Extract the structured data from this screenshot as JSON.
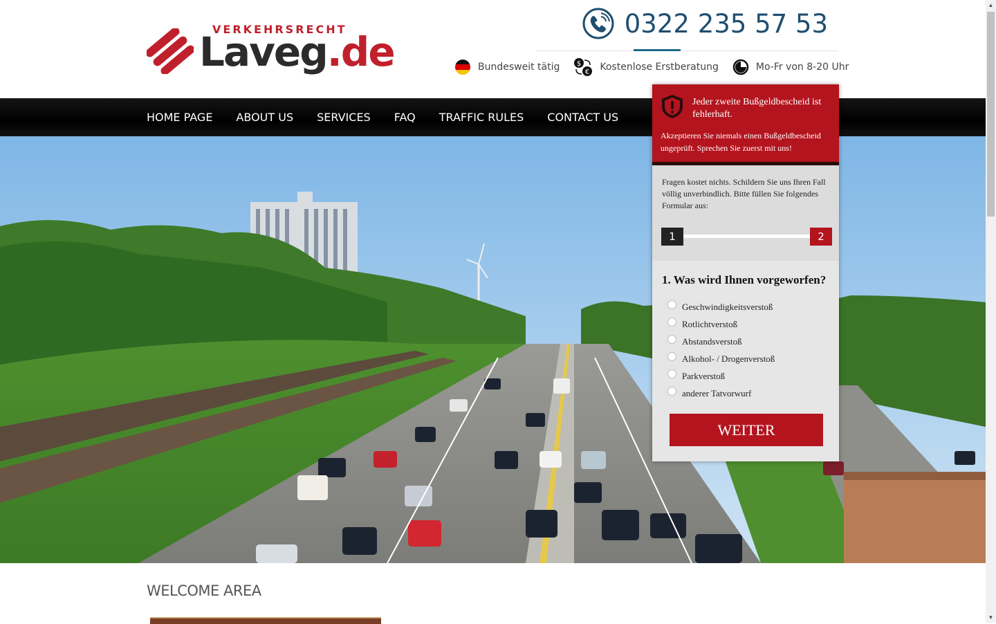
{
  "header": {
    "logo": {
      "top_text": "VERKEHRSRECHT",
      "brand_main": "Laveg",
      "brand_tld": ".de",
      "accent_color": "#c0202b"
    },
    "phone": "0322 235 57 53",
    "info": [
      {
        "icon": "germany-flag-icon",
        "label": "Bundesweit tätig"
      },
      {
        "icon": "coins-icon",
        "label": "Kostenlose Erstberatung"
      },
      {
        "icon": "clock-icon",
        "label": "Mo-Fr von 8-20 Uhr"
      }
    ]
  },
  "nav": {
    "items": [
      "HOME PAGE",
      "ABOUT US",
      "SERVICES",
      "FAQ",
      "TRAFFIC RULES",
      "CONTACT US"
    ]
  },
  "hero": {
    "image": "highway-traffic-photo"
  },
  "form": {
    "title": "Jeder zweite Bußgeldbescheid ist fehlerhaft.",
    "subtitle": "Akzeptieren Sie niemals einen Bußgeldbescheid ungeprüft. Sprechen Sie zuerst mit uns!",
    "intro": "Fragen kostet nichts. Schildern Sie uns Ihren Fall völlig unverbindlich. Bitte füllen Sie folgendes Formular aus:",
    "step_current": "1",
    "step_next": "2",
    "question": "1. Was wird Ihnen vorgeworfen?",
    "options": [
      "Geschwindigkeitsverstoß",
      "Rotlichtverstoß",
      "Abstandsverstoß",
      "Alkohol- / Drogenverstoß",
      "Parkverstoß",
      "anderer Tatvorwurf"
    ],
    "button": "WEITER",
    "brand_color": "#b3141e"
  },
  "welcome": {
    "heading": "WELCOME AREA"
  }
}
